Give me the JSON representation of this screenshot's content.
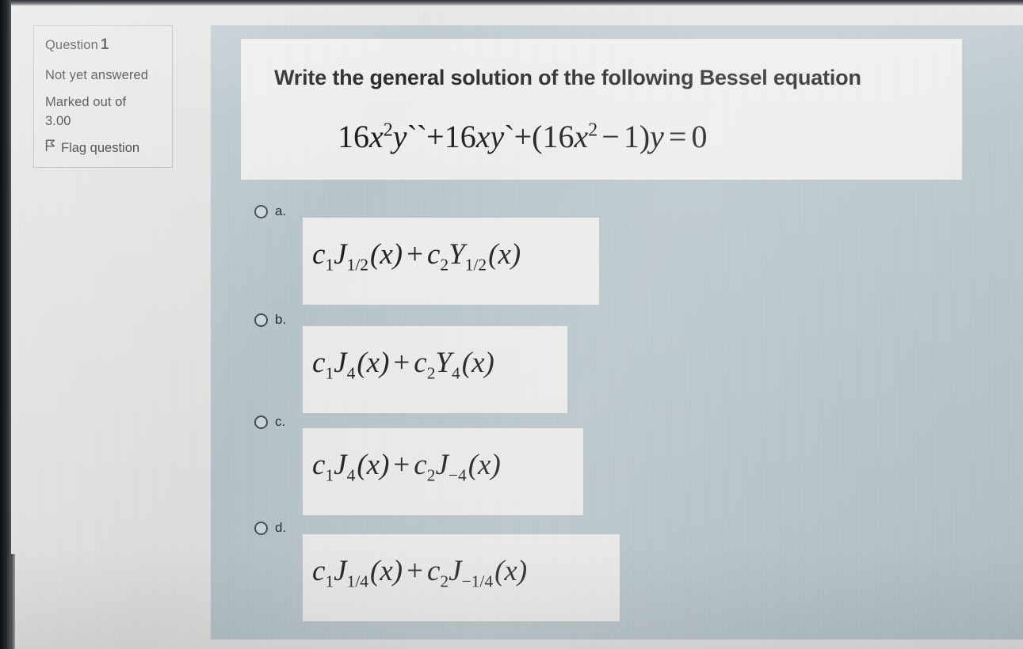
{
  "question_info": {
    "question_label": "Question",
    "question_number": "1",
    "status": "Not yet answered",
    "marked_label": "Marked out of",
    "marked_value": "3.00",
    "flag_label": "Flag question",
    "flag_icon": "flag-icon"
  },
  "question": {
    "stem": "Write the general solution of the following Bessel equation",
    "equation": {
      "plain": "16x²y``+16xy`+(16x² − 1)y = 0",
      "parts": {
        "c1": "16",
        "x1": "x",
        "x1_exp": "2",
        "y1": "y",
        "y1_primes": "``",
        "plus1": "+",
        "c2": "16",
        "x2": "x",
        "y2": "y",
        "y2_primes": "`",
        "plus2": "+",
        "open": "(",
        "c3": "16",
        "x3": "x",
        "x3_exp": "2",
        "minus": "−",
        "one": "1",
        "close": ")",
        "y3": "y",
        "eq": "=",
        "zero": "0"
      }
    }
  },
  "options": [
    {
      "letter": "a.",
      "plain": "c₁J₁⁄₂(x) + c₂Y₁⁄₂(x)",
      "parts": {
        "c_a": "c",
        "c_a_sub": "1",
        "fn_a": "J",
        "fn_a_sub": "1/2",
        "arg_a": "(x)",
        "plus": "+",
        "c_b": "c",
        "c_b_sub": "2",
        "fn_b": "Y",
        "fn_b_sub": "1/2",
        "arg_b": "(x)"
      },
      "selected": false
    },
    {
      "letter": "b.",
      "plain": "c₁J₄(x) + c₂Y₄(x)",
      "parts": {
        "c_a": "c",
        "c_a_sub": "1",
        "fn_a": "J",
        "fn_a_sub": "4",
        "arg_a": "(x)",
        "plus": "+",
        "c_b": "c",
        "c_b_sub": "2",
        "fn_b": "Y",
        "fn_b_sub": "4",
        "arg_b": "(x)"
      },
      "selected": false
    },
    {
      "letter": "c.",
      "plain": "c₁J₄(x) + c₂J₋₄(x)",
      "parts": {
        "c_a": "c",
        "c_a_sub": "1",
        "fn_a": "J",
        "fn_a_sub": "4",
        "arg_a": "(x)",
        "plus": "+",
        "c_b": "c",
        "c_b_sub": "2",
        "fn_b": "J",
        "fn_b_sub": "−4",
        "arg_b": "(x)"
      },
      "selected": false
    },
    {
      "letter": "d.",
      "plain": "c₁J₁⁄₄(x) + c₂J₋₁⁄₄(x)",
      "parts": {
        "c_a": "c",
        "c_a_sub": "1",
        "fn_a": "J",
        "fn_a_sub": "1/4",
        "arg_a": "(x)",
        "plus": "+",
        "c_b": "c",
        "c_b_sub": "2",
        "fn_b": "J",
        "fn_b_sub": "−1/4",
        "arg_b": "(x)"
      },
      "selected": false
    }
  ],
  "colors": {
    "panel_bg": "#b8c6cc",
    "page_bg": "#e4e4e2",
    "block_bg": "#f0efee",
    "text": "#13151a",
    "info_border": "#b9b9b7"
  }
}
